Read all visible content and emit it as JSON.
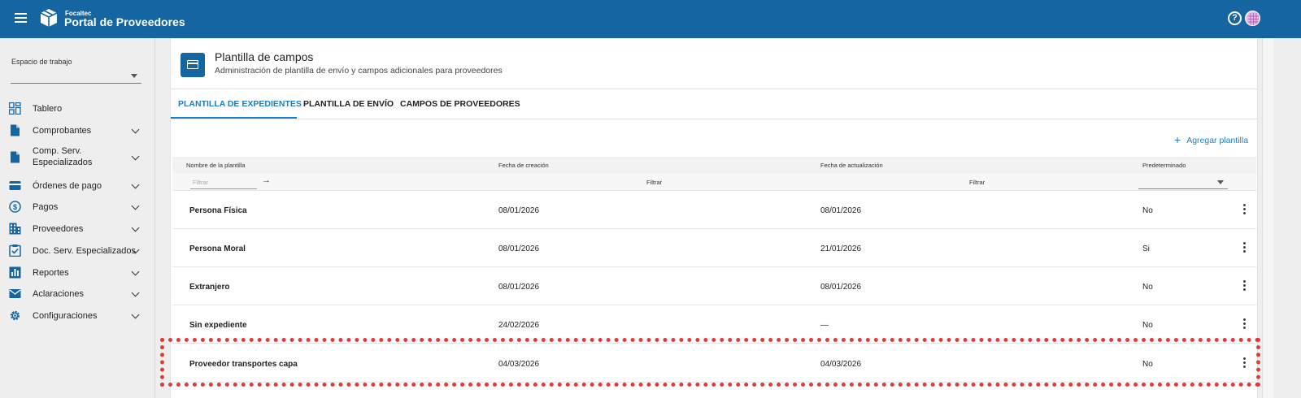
{
  "header": {
    "brand_small": "Focaltec",
    "brand_title": "Portal de Proveedores",
    "menu_icon": "hamburger-menu-icon",
    "logo_icon": "box-logo-icon",
    "help_icon": "help-icon",
    "help_glyph": "?",
    "avatar_icon": "user-avatar"
  },
  "sidebar": {
    "workspace_label": "Espacio de trabajo",
    "workspace_value": "",
    "items": [
      {
        "label": "Tablero",
        "icon": "dashboard-icon",
        "expandable": false
      },
      {
        "label": "Comprobantes",
        "icon": "document-icon",
        "expandable": true
      },
      {
        "label": "Comp. Serv. Especializados",
        "icon": "document-icon",
        "expandable": true
      },
      {
        "label": "Órdenes de pago",
        "icon": "credit-card-icon",
        "expandable": true
      },
      {
        "label": "Pagos",
        "icon": "dollar-icon",
        "expandable": true
      },
      {
        "label": "Proveedores",
        "icon": "building-icon",
        "expandable": true
      },
      {
        "label": "Doc. Serv. Especializados",
        "icon": "clipboard-check-icon",
        "expandable": true
      },
      {
        "label": "Reportes",
        "icon": "bar-chart-icon",
        "expandable": true
      },
      {
        "label": "Aclaraciones",
        "icon": "mail-icon",
        "expandable": true
      },
      {
        "label": "Configuraciones",
        "icon": "gear-icon",
        "expandable": true
      }
    ]
  },
  "page": {
    "title": "Plantilla de campos",
    "subtitle": "Administración de plantilla de envío y campos adicionales para proveedores",
    "icon": "card-icon"
  },
  "tabs": [
    {
      "label": "PLANTILLA DE EXPEDIENTES",
      "active": true
    },
    {
      "label": "PLANTILLA DE ENVÍO",
      "active": false
    },
    {
      "label": "CAMPOS DE PROVEEDORES",
      "active": false
    }
  ],
  "add_button": {
    "label": "Agregar plantilla",
    "icon": "plus-icon",
    "glyph": "+"
  },
  "table": {
    "headers": [
      "Nombre de la plantilla",
      "Fecha de creación",
      "Fecha de actualización",
      "Predeterminado"
    ],
    "filters": {
      "name_placeholder": "Filtrar",
      "created_label": "Filtrar",
      "updated_label": "Filtrar",
      "default_value": ""
    },
    "rows": [
      {
        "name": "Persona Física",
        "created": "08/01/2026",
        "updated": "08/01/2026",
        "default": "No"
      },
      {
        "name": "Persona Moral",
        "created": "08/01/2026",
        "updated": "21/01/2026",
        "default": "Si"
      },
      {
        "name": "Extranjero",
        "created": "08/01/2026",
        "updated": "08/01/2026",
        "default": "No"
      },
      {
        "name": "Sin expediente",
        "created": "24/02/2026",
        "updated": "—",
        "default": "No"
      },
      {
        "name": "Proveedor transportes capa",
        "created": "04/03/2026",
        "updated": "04/03/2026",
        "default": "No"
      }
    ]
  },
  "colors": {
    "primary": "#1565a0",
    "accent": "#1c7ec2",
    "highlight": "#e53935"
  }
}
